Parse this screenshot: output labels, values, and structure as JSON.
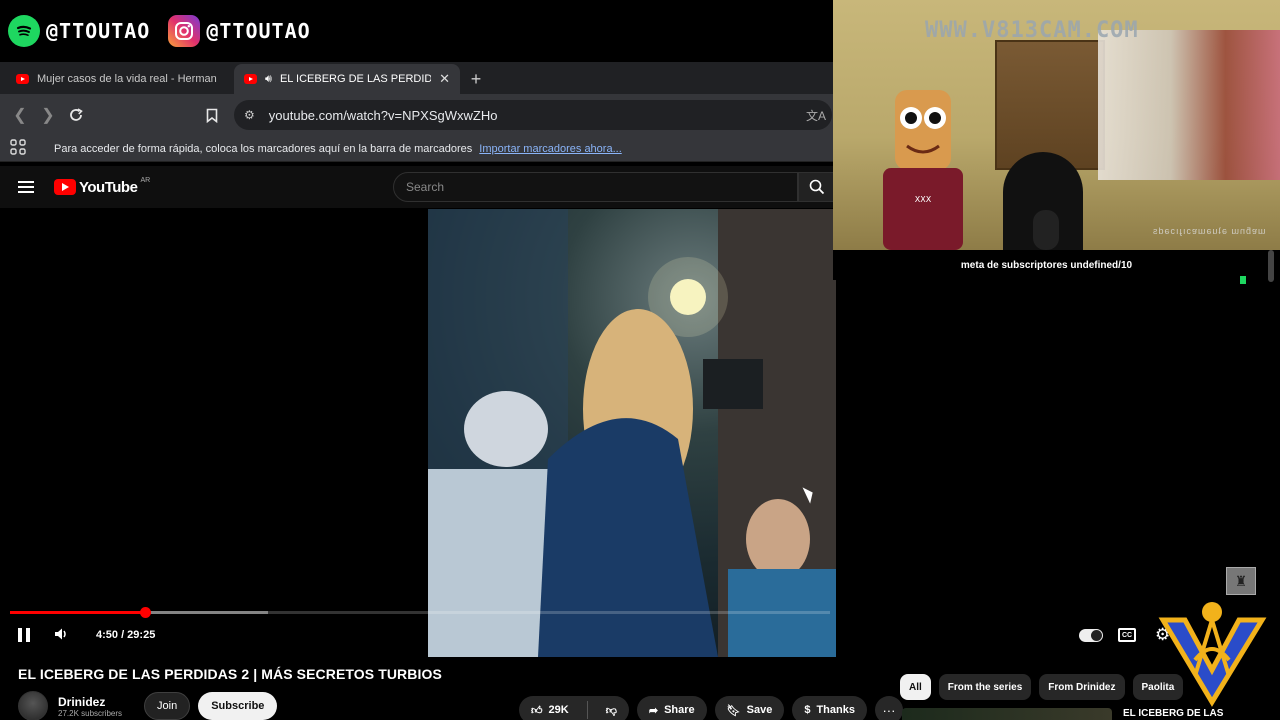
{
  "overlay": {
    "spotify_handle": "@TTOUTAO",
    "instagram_handle": "@TTOUTAO",
    "webcam_watermark": "WWW.V813CAM.COM",
    "webcam_caption": "ɯɐƃnɯ ǝʇuǝɯɐɔıɟıɔǝds",
    "sub_goal": "meta de subscriptores undefined/10"
  },
  "browser": {
    "tabs": [
      {
        "label": "Mujer casos de la vida real - Herman",
        "active": false
      },
      {
        "label": "EL ICEBERG DE LAS PERDIDAS",
        "active": true
      }
    ],
    "new_tab": "+",
    "url": "youtube.com/watch?v=NPXSgWxwZHo",
    "bookmarks_text": "Para acceder de forma rápida, coloca los marcadores aquí en la barra de marcadores",
    "bookmarks_link": "Importar marcadores ahora..."
  },
  "youtube": {
    "logo_text": "YouTube",
    "region": "AR",
    "search_placeholder": "Search",
    "time_display": "4:50 / 29:25",
    "progress": 0.165,
    "buffered": 0.315,
    "title": "EL ICEBERG DE LAS PERDIDAS 2 | MÁS SECRETOS TURBIOS",
    "channel": {
      "name": "Drinidez",
      "subscribers": "27.2K subscribers",
      "join": "Join",
      "subscribe": "Subscribe"
    },
    "actions": {
      "likes": "29K",
      "share": "Share",
      "save": "Save",
      "thanks": "Thanks",
      "more": "···"
    },
    "chips": [
      "All",
      "From the series",
      "From Drinidez",
      "Paolita"
    ],
    "recommendation_title": "EL ICEBERG DE LAS"
  },
  "colors": {
    "yt_red": "#ff0000",
    "spotify_green": "#1ed760",
    "link_blue": "#8ab4f8"
  }
}
